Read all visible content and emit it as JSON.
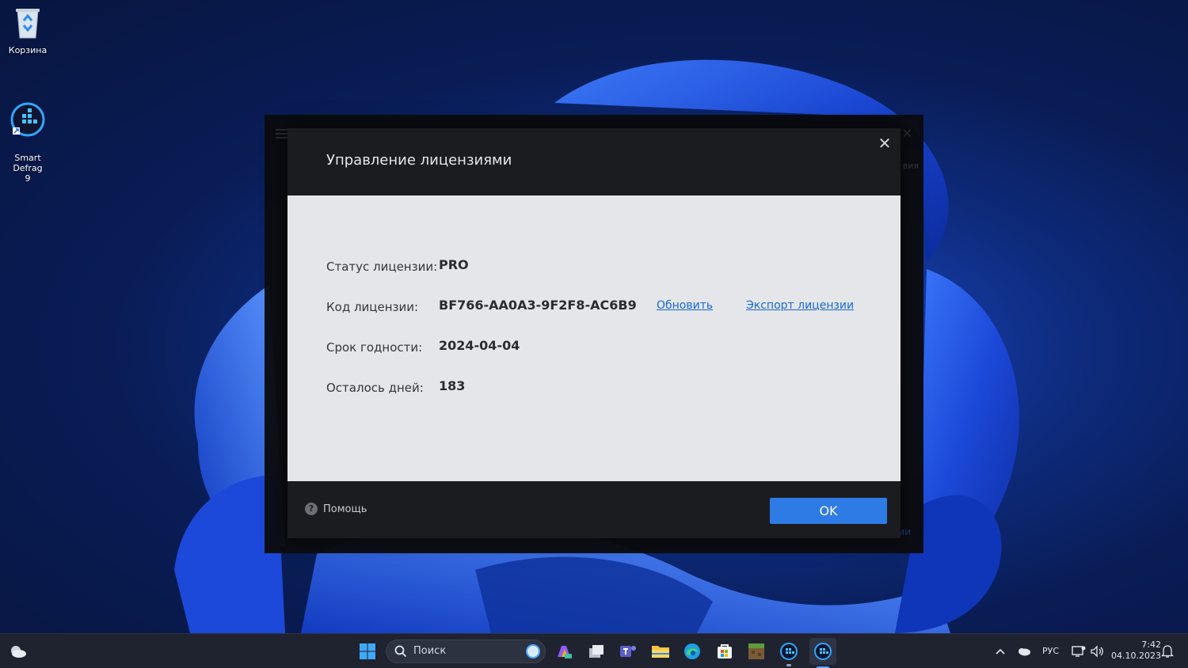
{
  "desktop": {
    "icons": [
      {
        "label": "Корзина"
      },
      {
        "label": "Smart Defrag\n9"
      }
    ]
  },
  "background_window": {
    "edge_text": "вия",
    "edge_link": "ии"
  },
  "dialog": {
    "title": "Управление лицензиями",
    "close_symbol": "✕",
    "rows": [
      {
        "label": "Статус лицензии:",
        "value": "PRO"
      },
      {
        "label": "Код лицензии:",
        "value": "BF766-AA0A3-9F2F8-AC6B9",
        "links": [
          "Обновить",
          "Экспорт лицензии"
        ]
      },
      {
        "label": "Срок годности:",
        "value": "2024-04-04"
      },
      {
        "label": "Осталось дней:",
        "value": "183"
      }
    ],
    "help_label": "Помощь",
    "ok_label": "OK"
  },
  "taskbar": {
    "search_placeholder": "Поиск",
    "language": "РУС",
    "time": "7:42",
    "date": "04.10.2023",
    "pinned_icons": [
      "windows-start-icon",
      "copilot-icon",
      "task-view-icon",
      "teams-icon",
      "file-explorer-icon",
      "edge-icon",
      "store-icon",
      "minecraft-icon",
      "smart-defrag-icon",
      "smart-defrag-active-icon"
    ]
  },
  "colors": {
    "accent": "#2f7be6",
    "link": "#1769d6",
    "dialog_dark": "#1b1c20",
    "dialog_body": "#e5e6e9"
  }
}
